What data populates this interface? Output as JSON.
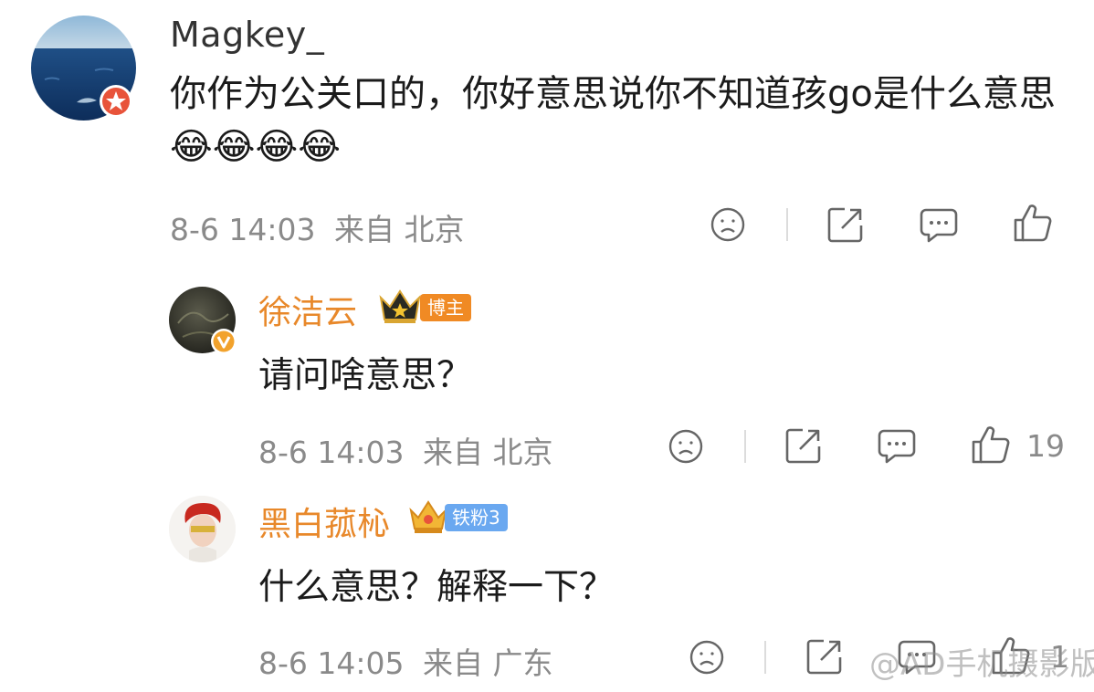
{
  "comments": [
    {
      "username": "Magkey_",
      "text": "你作为公关口的，你好意思说你不知道孩go是什么意思",
      "emojis": "😂😂😂😂",
      "date": "8-6 14:03",
      "location": "来自 北京"
    },
    {
      "username": "徐洁云",
      "badge": "博主",
      "text": "请问啥意思？",
      "date": "8-6 14:03",
      "location": "来自 北京",
      "like_count": "19"
    },
    {
      "username": "黑白菰杺",
      "badge": "铁粉3",
      "text": "什么意思？解释一下？",
      "date": "8-6 14:05",
      "location": "来自 广东",
      "like_count": "1"
    }
  ],
  "watermark": "@AD手机摄影版",
  "colors": {
    "username_sub": "#e8882a",
    "meta": "#8a8a8a",
    "badge_blogger": "#f08a24",
    "badge_fan": "#6aa8f0"
  },
  "icons": [
    "dislike-icon",
    "share-icon",
    "comment-icon",
    "like-icon"
  ]
}
